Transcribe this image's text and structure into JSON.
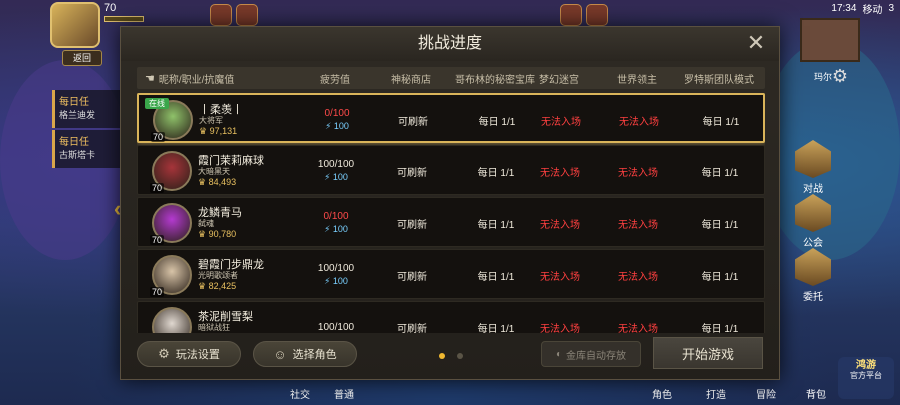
{
  "status_bar": {
    "time": "17:34",
    "carrier": "移动",
    "battery": "3"
  },
  "hud": {
    "level": "70",
    "back_label": "返回",
    "quest1": "每日任",
    "quest1_sub": "格兰迪发",
    "quest2": "每日任",
    "quest2_sub": "古斯塔卡",
    "right_label": "玛尔"
  },
  "right_menu": [
    {
      "label": "对战"
    },
    {
      "label": "公会"
    },
    {
      "label": "委托"
    }
  ],
  "bottom_nav": {
    "social": "社交",
    "normal": "普通",
    "role": "角色",
    "hit": "打造",
    "adventure": "冒险",
    "bag": "背包"
  },
  "watermark": {
    "line1": "鸿游",
    "line2": "官方平台"
  },
  "dialog": {
    "title": "挑战进度",
    "close_icon": "close-icon",
    "columns": [
      "昵称/职业/抗魔值",
      "疲劳值",
      "神秘商店",
      "哥布林的秘密宝库",
      "梦幻迷宫",
      "世界领主",
      "罗特斯团队模式"
    ],
    "rows": [
      {
        "online": "在线",
        "name": "丨柔羡丨",
        "job": "大将军",
        "power": "97,131",
        "level": "70",
        "fatigue": "0/100",
        "fatigue_zero": true,
        "bonus": "100",
        "shop": "可刷新",
        "goblin": "每日 1/1",
        "maze": "无法入场",
        "lord": "无法入场",
        "lotus": "每日 1/1",
        "color": "#8fc26a"
      },
      {
        "online": "",
        "name": "霞门茉莉麻球",
        "job": "大暗黑天",
        "power": "84,493",
        "level": "70",
        "fatigue": "100/100",
        "fatigue_zero": false,
        "bonus": "100",
        "shop": "可刷新",
        "goblin": "每日 1/1",
        "maze": "无法入场",
        "lord": "无法入场",
        "lotus": "每日 1/1",
        "color": "#a6343a"
      },
      {
        "online": "",
        "name": "龙鳞青马",
        "job": "弑魂",
        "power": "90,780",
        "level": "70",
        "fatigue": "0/100",
        "fatigue_zero": true,
        "bonus": "100",
        "shop": "可刷新",
        "goblin": "每日 1/1",
        "maze": "无法入场",
        "lord": "无法入场",
        "lotus": "每日 1/1",
        "color": "#b43ad0"
      },
      {
        "online": "",
        "name": "碧霞门步鼎龙",
        "job": "光明歌颂者",
        "power": "82,425",
        "level": "70",
        "fatigue": "100/100",
        "fatigue_zero": false,
        "bonus": "100",
        "shop": "可刷新",
        "goblin": "每日 1/1",
        "maze": "无法入场",
        "lord": "无法入场",
        "lotus": "每日 1/1",
        "color": "#d8c4a8"
      },
      {
        "online": "",
        "name": "茶泥削雪梨",
        "job": "暗狱战狂",
        "power": "",
        "level": "",
        "fatigue": "100/100",
        "fatigue_zero": false,
        "bonus": "",
        "shop": "可刷新",
        "goblin": "每日 1/1",
        "maze": "无法入场",
        "lord": "无法入场",
        "lotus": "每日 1/1",
        "color": "#e0d8d0"
      }
    ],
    "footer": {
      "settings_label": "玩法设置",
      "select_role_label": "选择角色",
      "autosave_label": "金库自动存放",
      "start_label": "开始游戏"
    }
  }
}
